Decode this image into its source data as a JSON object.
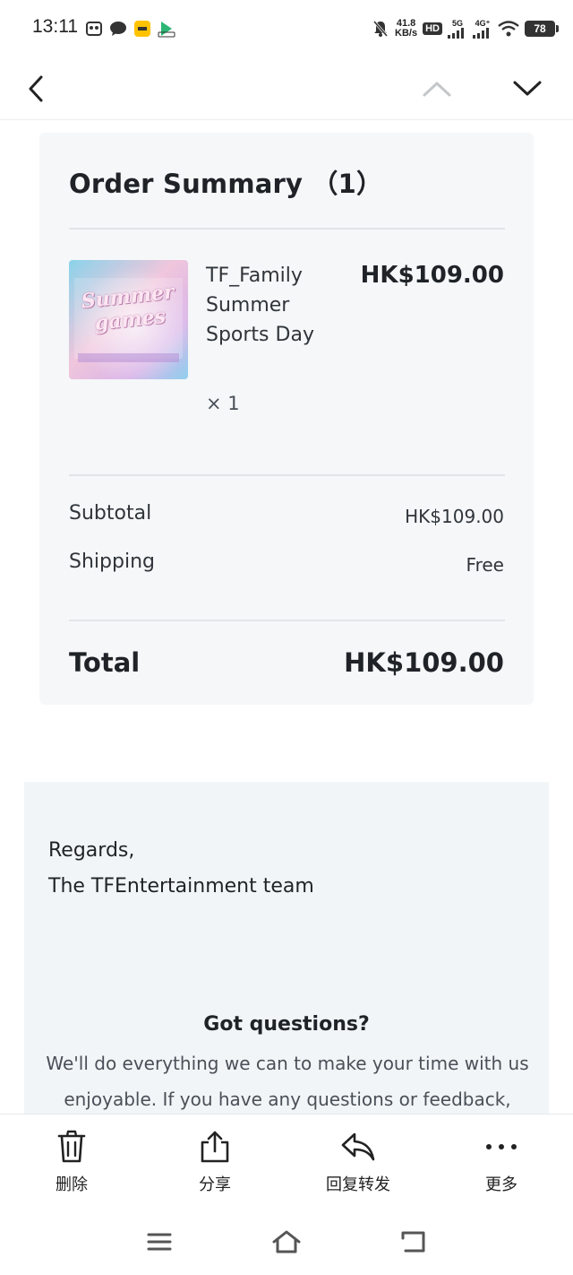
{
  "status_bar": {
    "time": "13:11",
    "net_speed_value": "41.8",
    "net_speed_unit": "KB/s",
    "hd_badge": "HD",
    "signal_1_label": "5G",
    "signal_2_label": "4G⁺",
    "battery": "78"
  },
  "order": {
    "title": "Order Summary （1）",
    "item": {
      "name": "TF_Family Summer Sports Day",
      "quantity": "× 1",
      "price": "HK$109.00",
      "thumbnail_text": "Summer games"
    },
    "subtotal_label": "Subtotal",
    "subtotal_value": "HK$109.00",
    "shipping_label": "Shipping",
    "shipping_value": "Free",
    "total_label": "Total",
    "total_value": "HK$109.00"
  },
  "footer": {
    "regards": "Regards,",
    "team": "The TFEntertainment team",
    "questions_title": "Got questions?",
    "questions_body": "We'll do everything we can to make your time with us enjoyable. If you have any questions or feedback, contact"
  },
  "actions": [
    {
      "label": "删除",
      "icon": "trash-icon"
    },
    {
      "label": "分享",
      "icon": "share-icon"
    },
    {
      "label": "回复转发",
      "icon": "reply-icon"
    },
    {
      "label": "更多",
      "icon": "more-icon"
    }
  ],
  "colors": {
    "card_bg": "#f5f7f9",
    "footer_bg": "#f2f5f7",
    "text_dark": "#1f2328"
  }
}
